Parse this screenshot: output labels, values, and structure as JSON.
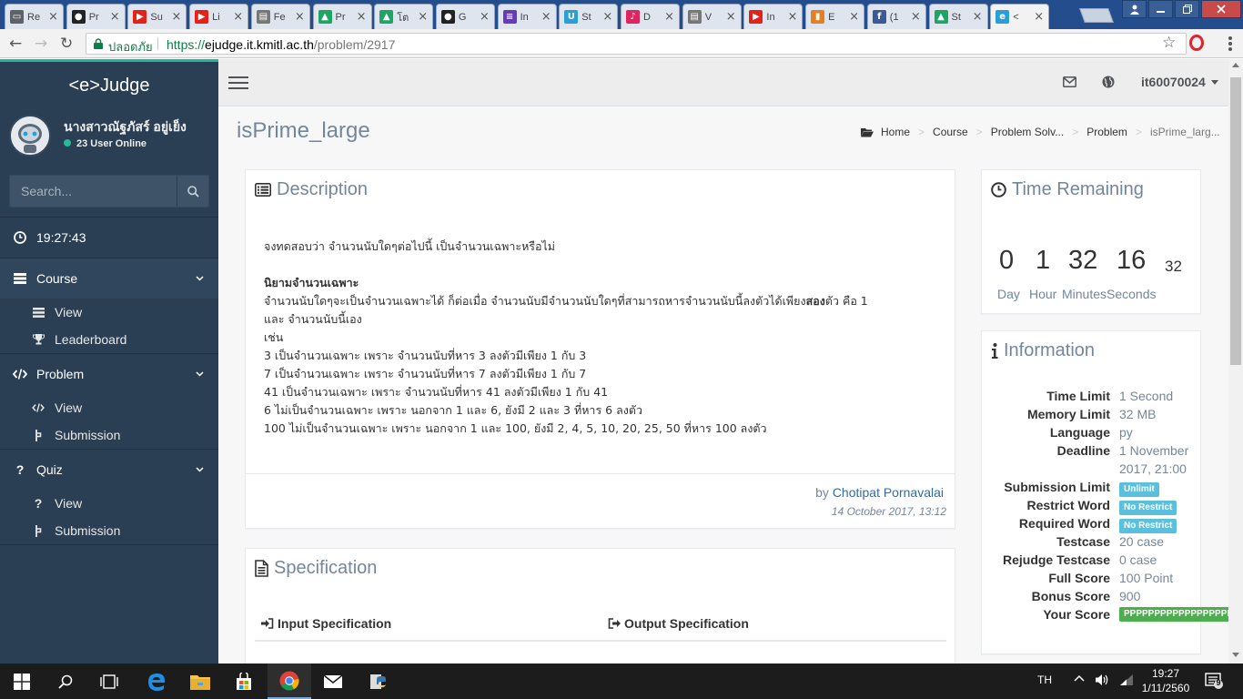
{
  "browser": {
    "tabs": [
      {
        "label": "Re",
        "icon": "slides-icon",
        "color": "#5f6368"
      },
      {
        "label": "Pr",
        "icon": "github-icon",
        "color": "#222222"
      },
      {
        "label": "Su",
        "icon": "youtube-icon",
        "color": "#e62117"
      },
      {
        "label": "Li",
        "icon": "youtube-icon",
        "color": "#e62117"
      },
      {
        "label": "Fe",
        "icon": "doc-icon",
        "color": "#777777"
      },
      {
        "label": "Pr",
        "icon": "drive-icon",
        "color": "#1fa463"
      },
      {
        "label": "โต",
        "icon": "drive-icon",
        "color": "#1fa463"
      },
      {
        "label": "G",
        "icon": "github-icon",
        "color": "#222222"
      },
      {
        "label": "In",
        "icon": "forms-icon",
        "color": "#673ab7"
      },
      {
        "label": "St",
        "icon": "u-icon",
        "color": "#2a9fd6"
      },
      {
        "label": "D",
        "icon": "music-icon",
        "color": "#e0245e"
      },
      {
        "label": "V",
        "icon": "doc-icon",
        "color": "#777777"
      },
      {
        "label": "In",
        "icon": "youtube-icon",
        "color": "#e62117"
      },
      {
        "label": "E",
        "icon": "bookmark-icon",
        "color": "#e67e22"
      },
      {
        "label": "(1",
        "icon": "facebook-icon",
        "color": "#3b5998"
      },
      {
        "label": "St",
        "icon": "drive-icon",
        "color": "#1fa463"
      },
      {
        "label": "<",
        "icon": "ejudge-icon",
        "color": "#2a9fd6",
        "close": "×"
      }
    ],
    "tab_close": "×",
    "secure_label": "ปลอดภัย",
    "url_scheme": "https://",
    "url_domain": "ejudge.it.kmitl.ac.th",
    "url_path": "/problem/2917"
  },
  "sidebar": {
    "brand": "<e>Judge",
    "username": "นางสาวณัฐภัสร์ อยู่เย็ง",
    "online": "23 User Online",
    "search_placeholder": "Search...",
    "clock": "19:27:43",
    "sections": [
      {
        "label": "Course",
        "items": [
          "View",
          "Leaderboard"
        ]
      },
      {
        "label": "Problem",
        "items": [
          "View",
          "Submission"
        ]
      },
      {
        "label": "Quiz",
        "items": [
          "View",
          "Submission"
        ]
      }
    ]
  },
  "topnav": {
    "user": "it60070024"
  },
  "page": {
    "title": "isPrime_large",
    "breadcrumb": [
      "Home",
      "Course",
      "Problem Solv...",
      "Problem",
      "isPrime_larg..."
    ]
  },
  "description": {
    "title": "Description",
    "intro": "จงทดสอบว่า จำนวนนับใดๆต่อไปนี้ เป็นจำนวนเฉพาะหรือไม่",
    "heading": "นิยามจำนวนเฉพาะ",
    "def_line1_a": "จำนวนนับใดๆจะเป็นจำนวนเฉพาะได้ ก็ต่อเมื่อ จำนวนนับมีจำนวนนับใดๆที่สามารถหารจำนวนนับนี้ลงตัวได้เพียง",
    "def_line1_bold": "สอง",
    "def_line1_b": "ตัว คือ 1",
    "def_line2": "และ จำนวนนับนี้เอง",
    "example_label": "เช่น",
    "examples": [
      "3 เป็นจำนวนเฉพาะ เพราะ จำนวนนับที่หาร 3 ลงตัวมีเพียง 1 กับ 3",
      "7 เป็นจำนวนเฉพาะ เพราะ จำนวนนับที่หาร 7 ลงตัวมีเพียง 1 กับ 7",
      "41 เป็นจำนวนเฉพาะ เพราะ จำนวนนับที่หาร 41 ลงตัวมีเพียง 1 กับ 41",
      "6 ไม่เป็นจำนวนเฉพาะ เพราะ นอกจาก 1 และ 6, ยังมี 2 และ 3 ที่หาร 6 ลงตัว",
      "100 ไม่เป็นจำนวนเฉพาะ เพราะ นอกจาก 1 และ 100, ยังมี 2, 4, 5, 10, 20, 25, 50 ที่หาร 100 ลงตัว"
    ],
    "by_label": "by",
    "author": "Chotipat Pornavalai",
    "date": "14 October 2017, 13:12"
  },
  "specification": {
    "title": "Specification",
    "input_label": "Input Specification",
    "output_label": "Output Specification"
  },
  "timer": {
    "title": "Time Remaining",
    "day": "0",
    "hour": "1",
    "minute": "32",
    "second": "16",
    "extra": "32",
    "labels": [
      "Day",
      "Hour",
      "Minutes",
      "Seconds"
    ]
  },
  "information": {
    "title": "Information",
    "rows": [
      {
        "key": "Time Limit",
        "value": "1 Second"
      },
      {
        "key": "Memory Limit",
        "value": "32 MB"
      },
      {
        "key": "Language",
        "value": "py"
      },
      {
        "key": "Deadline",
        "value": "1 November",
        "value2": "2017, 21:00"
      },
      {
        "key": "Submission Limit",
        "badge": "Unlimit"
      },
      {
        "key": "Restrict Word",
        "badge": "No Restrict"
      },
      {
        "key": "Required Word",
        "badge": "No Restrict"
      },
      {
        "key": "Testcase",
        "value": "20 case"
      },
      {
        "key": "Rejudge Testcase",
        "value": "0 case"
      },
      {
        "key": "Full Score",
        "value": "100 Point"
      },
      {
        "key": "Bonus Score",
        "value": "900"
      },
      {
        "key": "Your Score",
        "badge_green": "PPPPPPPPPPPPPPPPPPPP"
      }
    ]
  },
  "taskbar": {
    "lang": "TH",
    "time": "19:27",
    "date": "1/11/2560",
    "notif_count": "9"
  },
  "colors": {
    "sidebar": "#2a3f54",
    "accent": "#1abb9c",
    "link": "#2e6da4",
    "badge_blue": "#5bc0de",
    "badge_green": "#4cae4c"
  }
}
